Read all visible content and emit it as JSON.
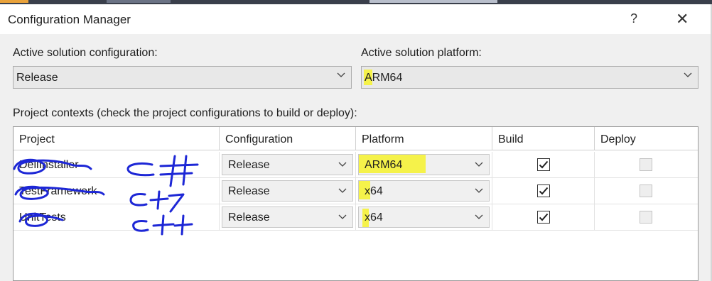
{
  "window": {
    "title": "Configuration Manager",
    "help_label": "?",
    "close_label": "✕"
  },
  "solution": {
    "config_label": "Active solution configuration:",
    "config_value": "Release",
    "platform_label": "Active solution platform:",
    "platform_value": "ARM64"
  },
  "contexts_label": "Project contexts (check the project configurations to build or deploy):",
  "table": {
    "columns": [
      "Project",
      "Configuration",
      "Platform",
      "Build",
      "Deploy"
    ],
    "rows": [
      {
        "project": "DellInstaller",
        "configuration": "Release",
        "platform": "ARM64",
        "build": true,
        "deploy": false,
        "deploy_enabled": false
      },
      {
        "project": "TestFramework",
        "configuration": "Release",
        "platform": "x64",
        "build": true,
        "deploy": false,
        "deploy_enabled": false
      },
      {
        "project": "UnitTests",
        "configuration": "Release",
        "platform": "x64",
        "build": true,
        "deploy": false,
        "deploy_enabled": false
      }
    ]
  },
  "annotations": [
    "C#",
    "C++",
    "C++"
  ],
  "colors": {
    "highlight": "#f5f24a",
    "ink": "#1d27d6",
    "dialog_bg": "#f0f0f0"
  },
  "icons": {
    "dropdown": "chevron-down-icon",
    "check": "checkmark-icon",
    "close": "close-icon",
    "help": "help-icon"
  }
}
